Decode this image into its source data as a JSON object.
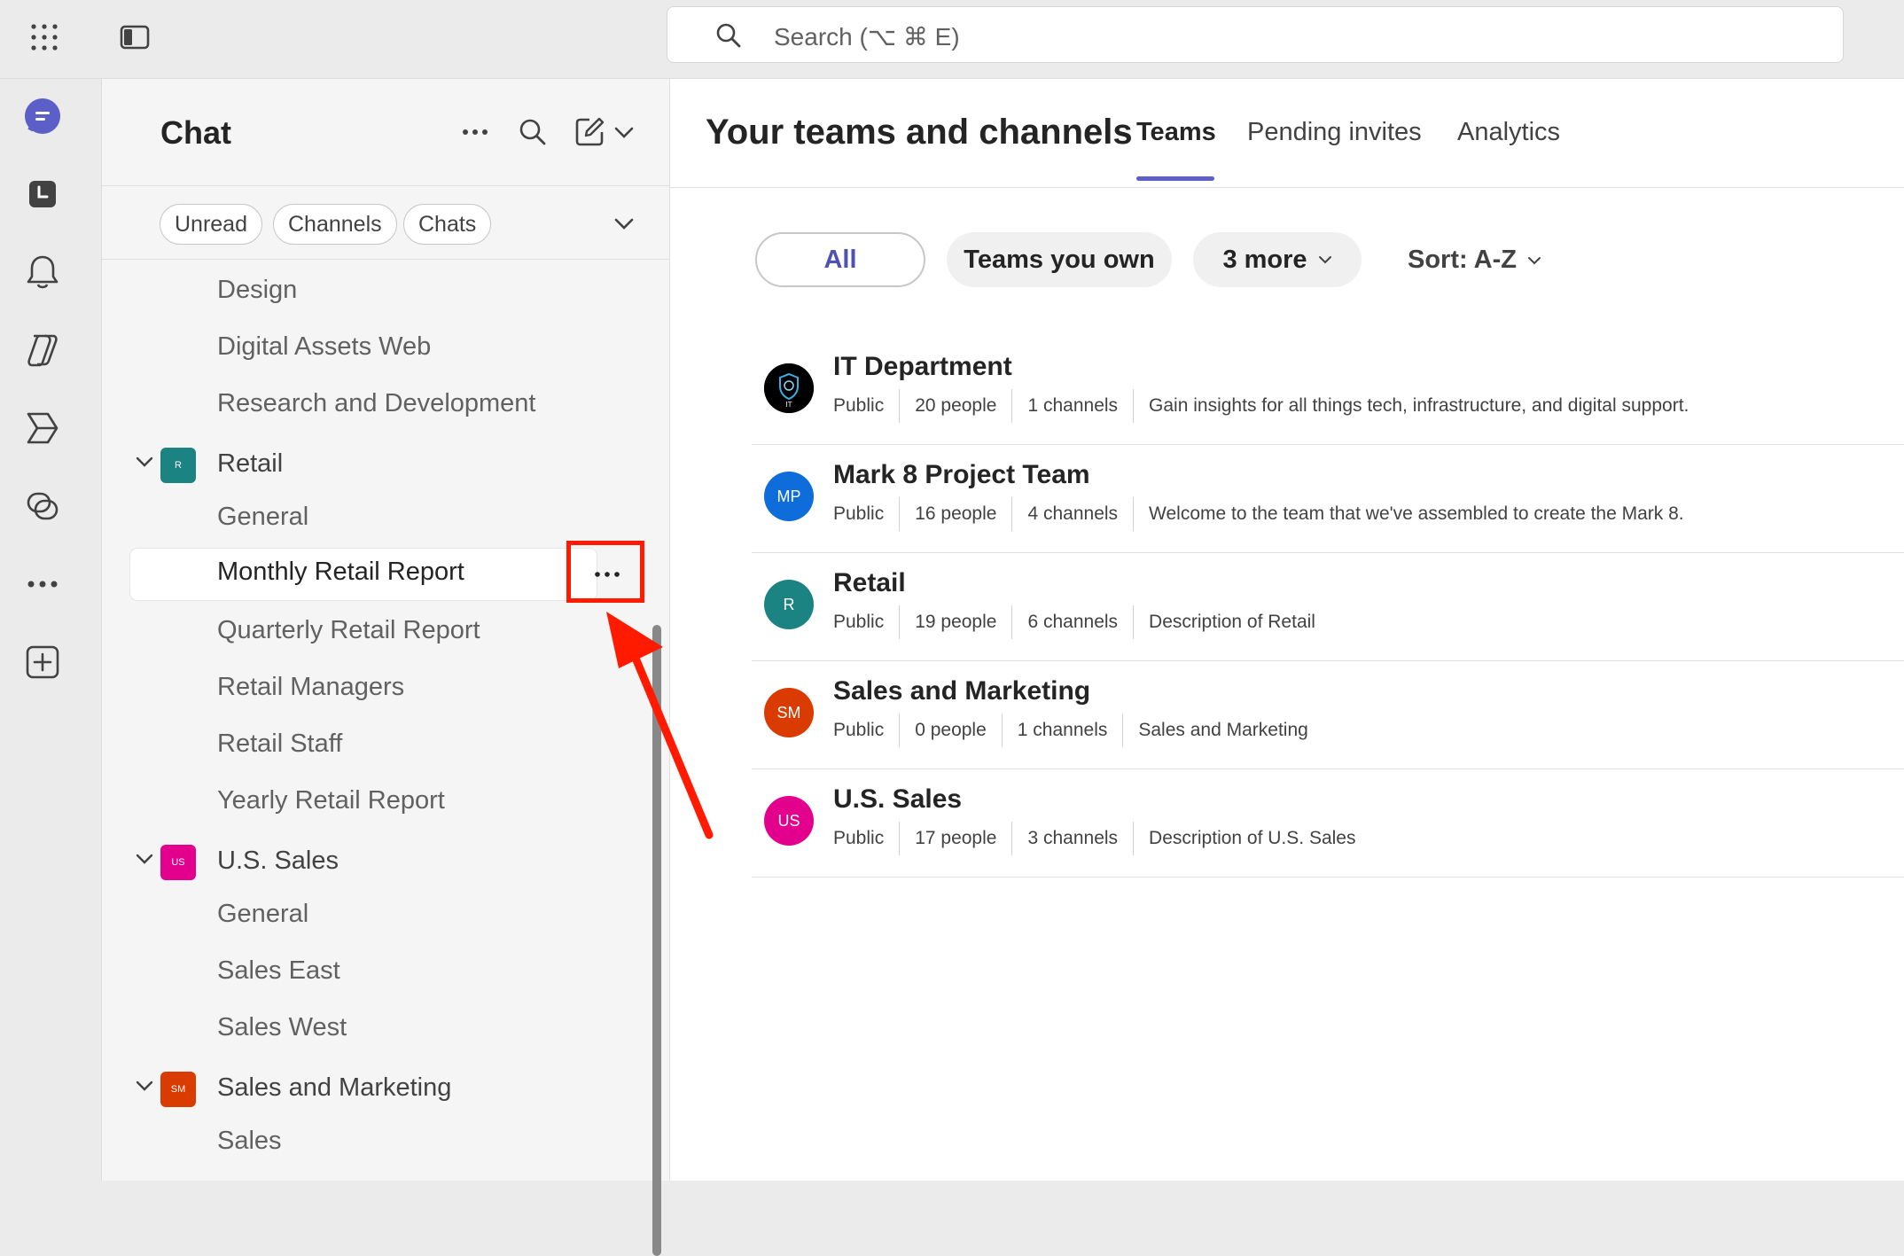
{
  "topbar": {
    "search_placeholder": "Search (⌥ ⌘ E)"
  },
  "rail": {
    "items": [
      "chat-icon",
      "calendar-icon",
      "bell-icon",
      "copilot-icon",
      "planner-icon",
      "loop-icon",
      "more-icon",
      "add-apps-icon"
    ]
  },
  "chat": {
    "title": "Chat",
    "filters": [
      "Unread",
      "Channels",
      "Chats"
    ],
    "channels_top": [
      "Design",
      "Digital Assets Web",
      "Research and Development"
    ],
    "teams": [
      {
        "name": "Retail",
        "initials": "R",
        "color": "#1b8381",
        "channels": [
          "General",
          "Monthly Retail Report",
          "Quarterly Retail Report",
          "Retail Managers",
          "Retail Staff",
          "Yearly Retail Report"
        ]
      },
      {
        "name": "U.S. Sales",
        "initials": "US",
        "color": "#e3008c",
        "channels": [
          "General",
          "Sales East",
          "Sales West"
        ]
      },
      {
        "name": "Sales and Marketing",
        "initials": "SM",
        "color": "#da3b01",
        "channels": [
          "Sales"
        ]
      }
    ],
    "selected_channel": "Monthly Retail Report"
  },
  "main": {
    "title": "Your teams and channels",
    "tabs": [
      "Teams",
      "Pending invites",
      "Analytics"
    ],
    "active_tab": "Teams",
    "filters": {
      "all": "All",
      "own": "Teams you own",
      "more": "3 more",
      "sort": "Sort: A-Z"
    },
    "teams": [
      {
        "name": "IT Department",
        "initials": "IT",
        "color": "#000000",
        "visibility": "Public",
        "people": "20 people",
        "channels": "1 channels",
        "description": "Gain insights for all things tech, infrastructure, and digital support."
      },
      {
        "name": "Mark 8 Project Team",
        "initials": "MP",
        "color": "#0f6cdb",
        "visibility": "Public",
        "people": "16 people",
        "channels": "4 channels",
        "description": "Welcome to the team that we've assembled to create the Mark 8."
      },
      {
        "name": "Retail",
        "initials": "R",
        "color": "#1b8381",
        "visibility": "Public",
        "people": "19 people",
        "channels": "6 channels",
        "description": "Description of Retail"
      },
      {
        "name": "Sales and Marketing",
        "initials": "SM",
        "color": "#da3b01",
        "visibility": "Public",
        "people": "0 people",
        "channels": "1 channels",
        "description": "Sales and Marketing"
      },
      {
        "name": "U.S. Sales",
        "initials": "US",
        "color": "#e3008c",
        "visibility": "Public",
        "people": "17 people",
        "channels": "3 channels",
        "description": "Description of U.S. Sales"
      }
    ]
  },
  "annotation_color": "#ff1a00"
}
